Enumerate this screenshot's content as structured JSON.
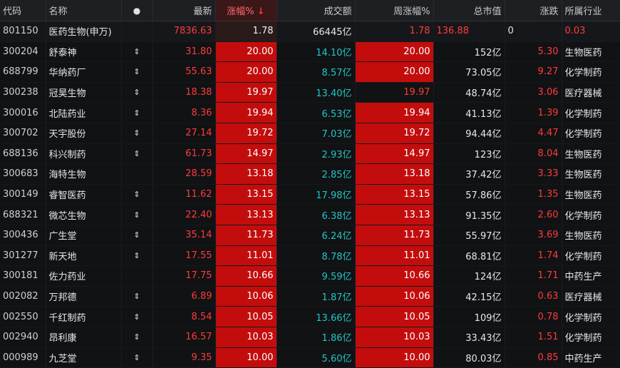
{
  "columns": {
    "code": "代码",
    "name": "名称",
    "dot": "●",
    "latest": "最新",
    "pct": "涨幅%",
    "sort_arrow": "↓",
    "volume": "成交额",
    "week_pct": "周涨幅%",
    "mktcap": "总市值",
    "updown": "涨跌",
    "industry": "所属行业"
  },
  "index_row": {
    "code": "801150",
    "name": "医药生物(申万)",
    "latest": "7836.63",
    "pct": "1.78",
    "volume": "66445亿",
    "week_pct": "1.78",
    "mktcap": "136.88",
    "updown": "0",
    "industry": "0.03"
  },
  "rows": [
    {
      "code": "300204",
      "name": "舒泰神",
      "mark": "⇕",
      "latest": "31.80",
      "pct": "20.00",
      "volume": "14.10亿",
      "week_pct": "20.00",
      "week_bg": true,
      "mktcap": "152亿",
      "updown": "5.30",
      "industry": "生物医药"
    },
    {
      "code": "688799",
      "name": "华纳药厂",
      "mark": "⇕",
      "latest": "55.63",
      "pct": "20.00",
      "volume": "8.57亿",
      "week_pct": "20.00",
      "week_bg": true,
      "mktcap": "73.05亿",
      "updown": "9.27",
      "industry": "化学制药"
    },
    {
      "code": "300238",
      "name": "冠昊生物",
      "mark": "⇕",
      "latest": "18.38",
      "pct": "19.97",
      "volume": "13.40亿",
      "week_pct": "19.97",
      "week_bg": false,
      "mktcap": "48.74亿",
      "updown": "3.06",
      "industry": "医疗器械"
    },
    {
      "code": "300016",
      "name": "北陆药业",
      "mark": "⇕",
      "latest": "8.36",
      "pct": "19.94",
      "volume": "6.53亿",
      "week_pct": "19.94",
      "week_bg": true,
      "mktcap": "41.13亿",
      "updown": "1.39",
      "industry": "化学制药"
    },
    {
      "code": "300702",
      "name": "天宇股份",
      "mark": "⇕",
      "latest": "27.14",
      "pct": "19.72",
      "volume": "7.03亿",
      "week_pct": "19.72",
      "week_bg": true,
      "mktcap": "94.44亿",
      "updown": "4.47",
      "industry": "化学制药"
    },
    {
      "code": "688136",
      "name": "科兴制药",
      "mark": "⇕",
      "latest": "61.73",
      "pct": "14.97",
      "volume": "2.93亿",
      "week_pct": "14.97",
      "week_bg": true,
      "mktcap": "123亿",
      "updown": "8.04",
      "industry": "生物医药"
    },
    {
      "code": "300683",
      "name": "海特生物",
      "mark": "",
      "latest": "28.59",
      "pct": "13.18",
      "volume": "2.85亿",
      "week_pct": "13.18",
      "week_bg": true,
      "mktcap": "37.42亿",
      "updown": "3.33",
      "industry": "生物医药"
    },
    {
      "code": "300149",
      "name": "睿智医药",
      "mark": "⇕",
      "latest": "11.62",
      "pct": "13.15",
      "volume": "17.98亿",
      "week_pct": "13.15",
      "week_bg": true,
      "mktcap": "57.86亿",
      "updown": "1.35",
      "industry": "生物医药"
    },
    {
      "code": "688321",
      "name": "微芯生物",
      "mark": "⇕",
      "latest": "22.40",
      "pct": "13.13",
      "volume": "6.38亿",
      "week_pct": "13.13",
      "week_bg": true,
      "mktcap": "91.35亿",
      "updown": "2.60",
      "industry": "化学制药"
    },
    {
      "code": "300436",
      "name": "广生堂",
      "mark": "⇕",
      "latest": "35.14",
      "pct": "11.73",
      "volume": "6.24亿",
      "week_pct": "11.73",
      "week_bg": true,
      "mktcap": "55.97亿",
      "updown": "3.69",
      "industry": "生物医药"
    },
    {
      "code": "301277",
      "name": "新天地",
      "mark": "⇕",
      "latest": "17.55",
      "pct": "11.01",
      "volume": "8.78亿",
      "week_pct": "11.01",
      "week_bg": true,
      "mktcap": "68.81亿",
      "updown": "1.74",
      "industry": "化学制药"
    },
    {
      "code": "300181",
      "name": "佐力药业",
      "mark": "",
      "latest": "17.75",
      "pct": "10.66",
      "volume": "9.59亿",
      "week_pct": "10.66",
      "week_bg": true,
      "mktcap": "124亿",
      "updown": "1.71",
      "industry": "中药生产"
    },
    {
      "code": "002082",
      "name": "万邦德",
      "mark": "⇕",
      "latest": "6.89",
      "pct": "10.06",
      "volume": "1.87亿",
      "week_pct": "10.06",
      "week_bg": true,
      "mktcap": "42.15亿",
      "updown": "0.63",
      "industry": "医疗器械"
    },
    {
      "code": "002550",
      "name": "千红制药",
      "mark": "⇕",
      "latest": "8.54",
      "pct": "10.05",
      "volume": "13.66亿",
      "week_pct": "10.05",
      "week_bg": true,
      "mktcap": "109亿",
      "updown": "0.78",
      "industry": "化学制药"
    },
    {
      "code": "002940",
      "name": "昂利康",
      "mark": "⇕",
      "latest": "16.57",
      "pct": "10.03",
      "volume": "1.86亿",
      "week_pct": "10.03",
      "week_bg": true,
      "mktcap": "33.43亿",
      "updown": "1.51",
      "industry": "化学制药"
    },
    {
      "code": "000989",
      "name": "九芝堂",
      "mark": "⇕",
      "latest": "9.35",
      "pct": "10.00",
      "volume": "5.60亿",
      "week_pct": "10.00",
      "week_bg": true,
      "mktcap": "80.03亿",
      "updown": "0.85",
      "industry": "中药生产"
    }
  ]
}
